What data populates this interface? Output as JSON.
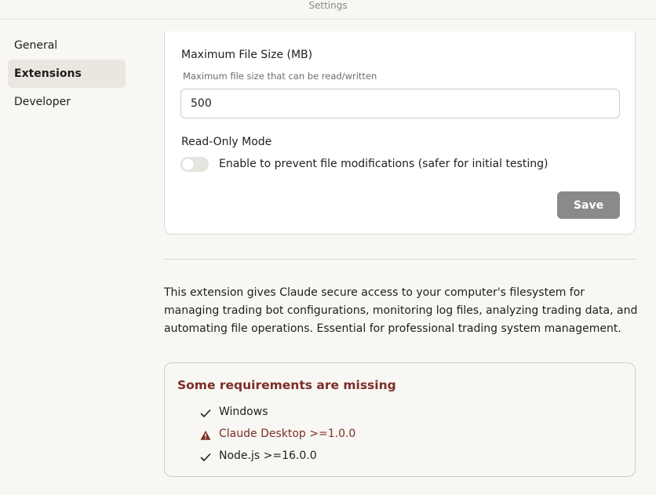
{
  "window": {
    "title": "Settings"
  },
  "sidebar": {
    "items": [
      {
        "label": "General",
        "active": false
      },
      {
        "label": "Extensions",
        "active": true
      },
      {
        "label": "Developer",
        "active": false
      }
    ]
  },
  "settings": {
    "max_file_size": {
      "label": "Maximum File Size (MB)",
      "help": "Maximum file size that can be read/written",
      "value": "500"
    },
    "read_only": {
      "label": "Read-Only Mode",
      "toggle_label": "Enable to prevent file modifications (safer for initial testing)",
      "enabled": false
    },
    "save_label": "Save"
  },
  "description": "This extension gives Claude secure access to your computer's filesystem for managing trading bot configurations, monitoring log files, analyzing trading data, and automating file operations. Essential for professional trading system management.",
  "requirements": {
    "title": "Some requirements are missing",
    "items": [
      {
        "label": "Windows",
        "status": "met",
        "icon": "check-icon"
      },
      {
        "label": "Claude Desktop >=1.0.0",
        "status": "missing",
        "icon": "warning-icon"
      },
      {
        "label": "Node.js >=16.0.0",
        "status": "met",
        "icon": "check-icon"
      }
    ]
  },
  "colors": {
    "background": "#f8f7f3",
    "accent_warning": "#7b2d26",
    "save_button": "#8a8a88",
    "active_nav": "#e9e7e0"
  }
}
